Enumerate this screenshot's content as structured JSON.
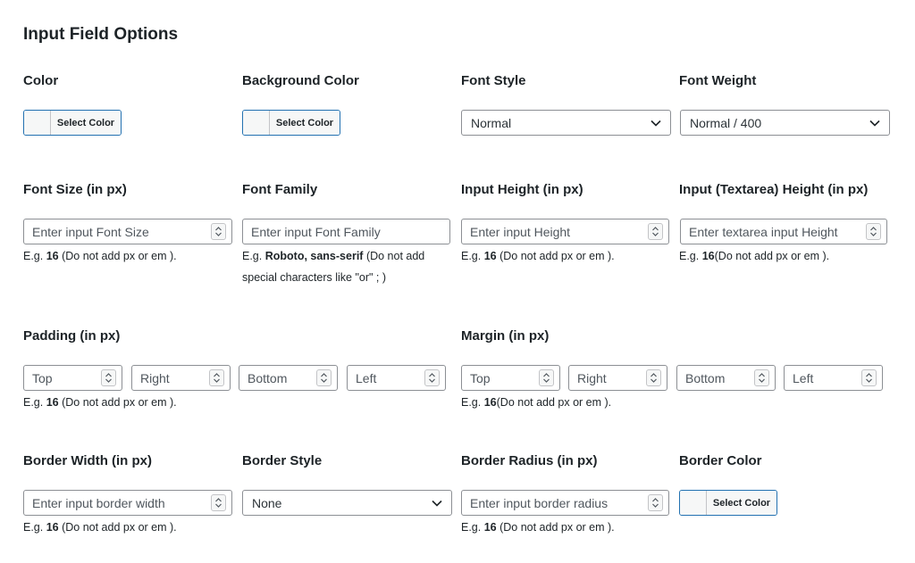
{
  "section_title": "Input Field Options",
  "row1": {
    "color": {
      "label": "Color",
      "button": "Select Color"
    },
    "background_color": {
      "label": "Background Color",
      "button": "Select Color"
    },
    "font_style": {
      "label": "Font Style",
      "value": "Normal"
    },
    "font_weight": {
      "label": "Font Weight",
      "value": "Normal / 400"
    }
  },
  "row2": {
    "font_size": {
      "label": "Font Size (in px)",
      "placeholder": "Enter input Font Size",
      "hint_pre": "E.g. ",
      "hint_bold": "16",
      "hint_post": " (Do not add px or em )."
    },
    "font_family": {
      "label": "Font Family",
      "placeholder": "Enter input Font Family",
      "hint_pre": "E.g. ",
      "hint_bold": "Roboto, sans-serif",
      "hint_post": " (Do not add",
      "hint_line2": "special characters like \"or\" ; )"
    },
    "input_height": {
      "label": "Input Height (in px)",
      "placeholder": "Enter input Height",
      "hint_pre": "E.g. ",
      "hint_bold": "16",
      "hint_post": " (Do not add px or em )."
    },
    "textarea_height": {
      "label": "Input (Textarea) Height (in px)",
      "placeholder": "Enter textarea input Height",
      "hint_pre": "E.g. ",
      "hint_bold": "16",
      "hint_post": "(Do not add px or em )."
    }
  },
  "row3": {
    "padding": {
      "label": "Padding (in px)",
      "fields": [
        "Top",
        "Right",
        "Bottom",
        "Left"
      ],
      "hint_pre": "E.g. ",
      "hint_bold": "16",
      "hint_post": " (Do not add px or em )."
    },
    "margin": {
      "label": "Margin (in px)",
      "fields": [
        "Top",
        "Right",
        "Bottom",
        "Left"
      ],
      "hint_pre": "E.g. ",
      "hint_bold": "16",
      "hint_post": "(Do not add px or em )."
    }
  },
  "row4": {
    "border_width": {
      "label": "Border Width (in px)",
      "placeholder": "Enter input border width",
      "hint_pre": "E.g. ",
      "hint_bold": "16",
      "hint_post": " (Do not add px or em )."
    },
    "border_style": {
      "label": "Border Style",
      "value": "None"
    },
    "border_radius": {
      "label": "Border Radius (in px)",
      "placeholder": "Enter input border radius",
      "hint_pre": "E.g. ",
      "hint_bold": "16",
      "hint_post": " (Do not add px or em )."
    },
    "border_color": {
      "label": "Border Color",
      "button": "Select Color"
    }
  },
  "icons": {
    "select_arrow": "chevron-down-icon",
    "number_spinner": "spinner-icon"
  },
  "colors": {
    "accent": "#2271b1",
    "border": "#8c8f94",
    "text": "#1d2327"
  }
}
